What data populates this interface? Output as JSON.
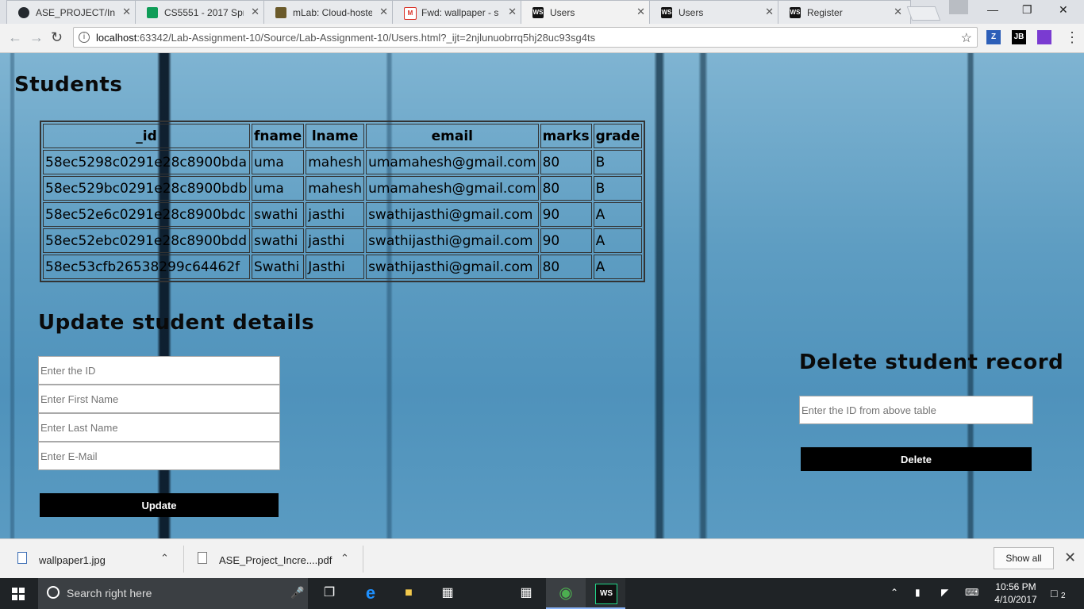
{
  "browser": {
    "tabs": [
      {
        "title": "ASE_PROJECT/Incr",
        "icon": "github-icon",
        "color": "#24292e",
        "active": false
      },
      {
        "title": "CS5551 - 2017 Spr",
        "icon": "sheets-icon",
        "color": "#0f9d58",
        "active": false
      },
      {
        "title": "mLab: Cloud-hoste",
        "icon": "mlab-icon",
        "color": "#6b5a2a",
        "active": false
      },
      {
        "title": "Fwd: wallpaper - s",
        "icon": "gmail-icon",
        "color": "#d93025",
        "active": false
      },
      {
        "title": "Users",
        "icon": "webstorm-icon",
        "color": "#111111",
        "active": true
      },
      {
        "title": "Users",
        "icon": "webstorm-icon",
        "color": "#111111",
        "active": false
      },
      {
        "title": "Register",
        "icon": "webstorm-icon",
        "color": "#111111",
        "active": false
      }
    ],
    "fav_labels": {
      "github": "",
      "sheets": "",
      "mlab": "",
      "gmail": "M",
      "ws": "WS"
    },
    "url_host": "localhost",
    "url_path": ":63342/Lab-Assignment-10/Source/Lab-Assignment-10/Users.html?_ijt=2njlunuobrrq5hj28uc93sg4ts",
    "extensions": [
      {
        "label": "Z",
        "color": "#2d5fb8"
      },
      {
        "label": "JB",
        "color": "#000000"
      },
      {
        "label": "",
        "color": "#7a3bd1"
      }
    ],
    "close_glyph": "✕"
  },
  "page": {
    "title": "Students",
    "table": {
      "headers": [
        "_id",
        "fname",
        "lname",
        "email",
        "marks",
        "grade"
      ],
      "rows": [
        [
          "58ec5298c0291e28c8900bda",
          "uma",
          "mahesh",
          "umamahesh@gmail.com",
          "80",
          "B"
        ],
        [
          "58ec529bc0291e28c8900bdb",
          "uma",
          "mahesh",
          "umamahesh@gmail.com",
          "80",
          "B"
        ],
        [
          "58ec52e6c0291e28c8900bdc",
          "swathi",
          "jasthi",
          "swathijasthi@gmail.com",
          "90",
          "A"
        ],
        [
          "58ec52ebc0291e28c8900bdd",
          "swathi",
          "jasthi",
          "swathijasthi@gmail.com",
          "90",
          "A"
        ],
        [
          "58ec53cfb26538299c64462f",
          "Swathi",
          "Jasthi",
          "swathijasthi@gmail.com",
          "80",
          "A"
        ]
      ]
    },
    "update": {
      "title": "Update student details",
      "id_placeholder": "Enter the ID",
      "fname_placeholder": "Enter First Name",
      "lname_placeholder": "Enter Last Name",
      "email_placeholder": "Enter E-Mail",
      "button": "Update"
    },
    "delete": {
      "title": "Delete student record",
      "id_placeholder": "Enter the ID from above table",
      "button": "Delete"
    }
  },
  "downloads": {
    "items": [
      {
        "name": "wallpaper1.jpg",
        "icon": "image-file-icon"
      },
      {
        "name": "ASE_Project_Incre....pdf",
        "icon": "pdf-file-icon"
      }
    ],
    "show_all": "Show all"
  },
  "taskbar": {
    "search_placeholder": "Search right here",
    "time": "10:56 PM",
    "date": "4/10/2017",
    "notification_count": "2",
    "icons": [
      "task-view-icon",
      "edge-icon",
      "file-explorer-icon",
      "store-icon",
      "calculator-icon",
      "chrome-icon",
      "webstorm-icon"
    ]
  }
}
